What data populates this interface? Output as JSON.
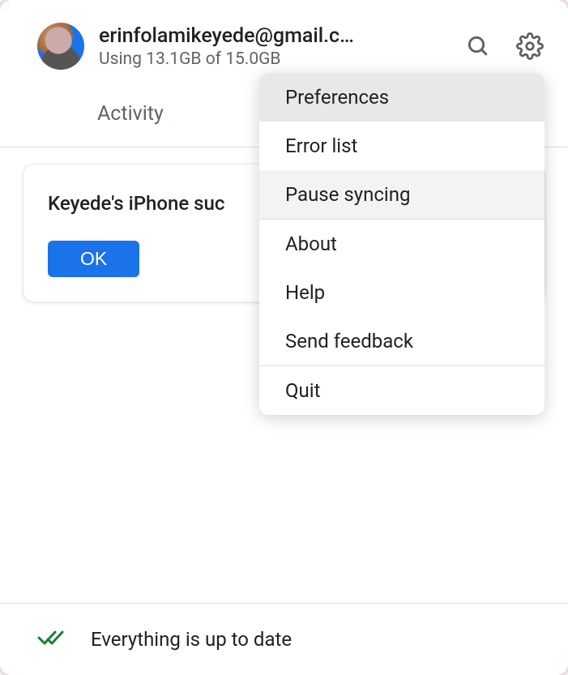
{
  "header": {
    "email": "erinfolamikeyede@gmail.c…",
    "storage": "Using 13.1GB of 15.0GB"
  },
  "tabs": {
    "activity": "Activity"
  },
  "notification": {
    "text": "Keyede's iPhone suc",
    "ok_label": "OK"
  },
  "menu": {
    "preferences": "Preferences",
    "error_list": "Error list",
    "pause_syncing": "Pause syncing",
    "about": "About",
    "help": "Help",
    "send_feedback": "Send feedback",
    "quit": "Quit"
  },
  "footer": {
    "status_text": "Everything is up to date"
  }
}
